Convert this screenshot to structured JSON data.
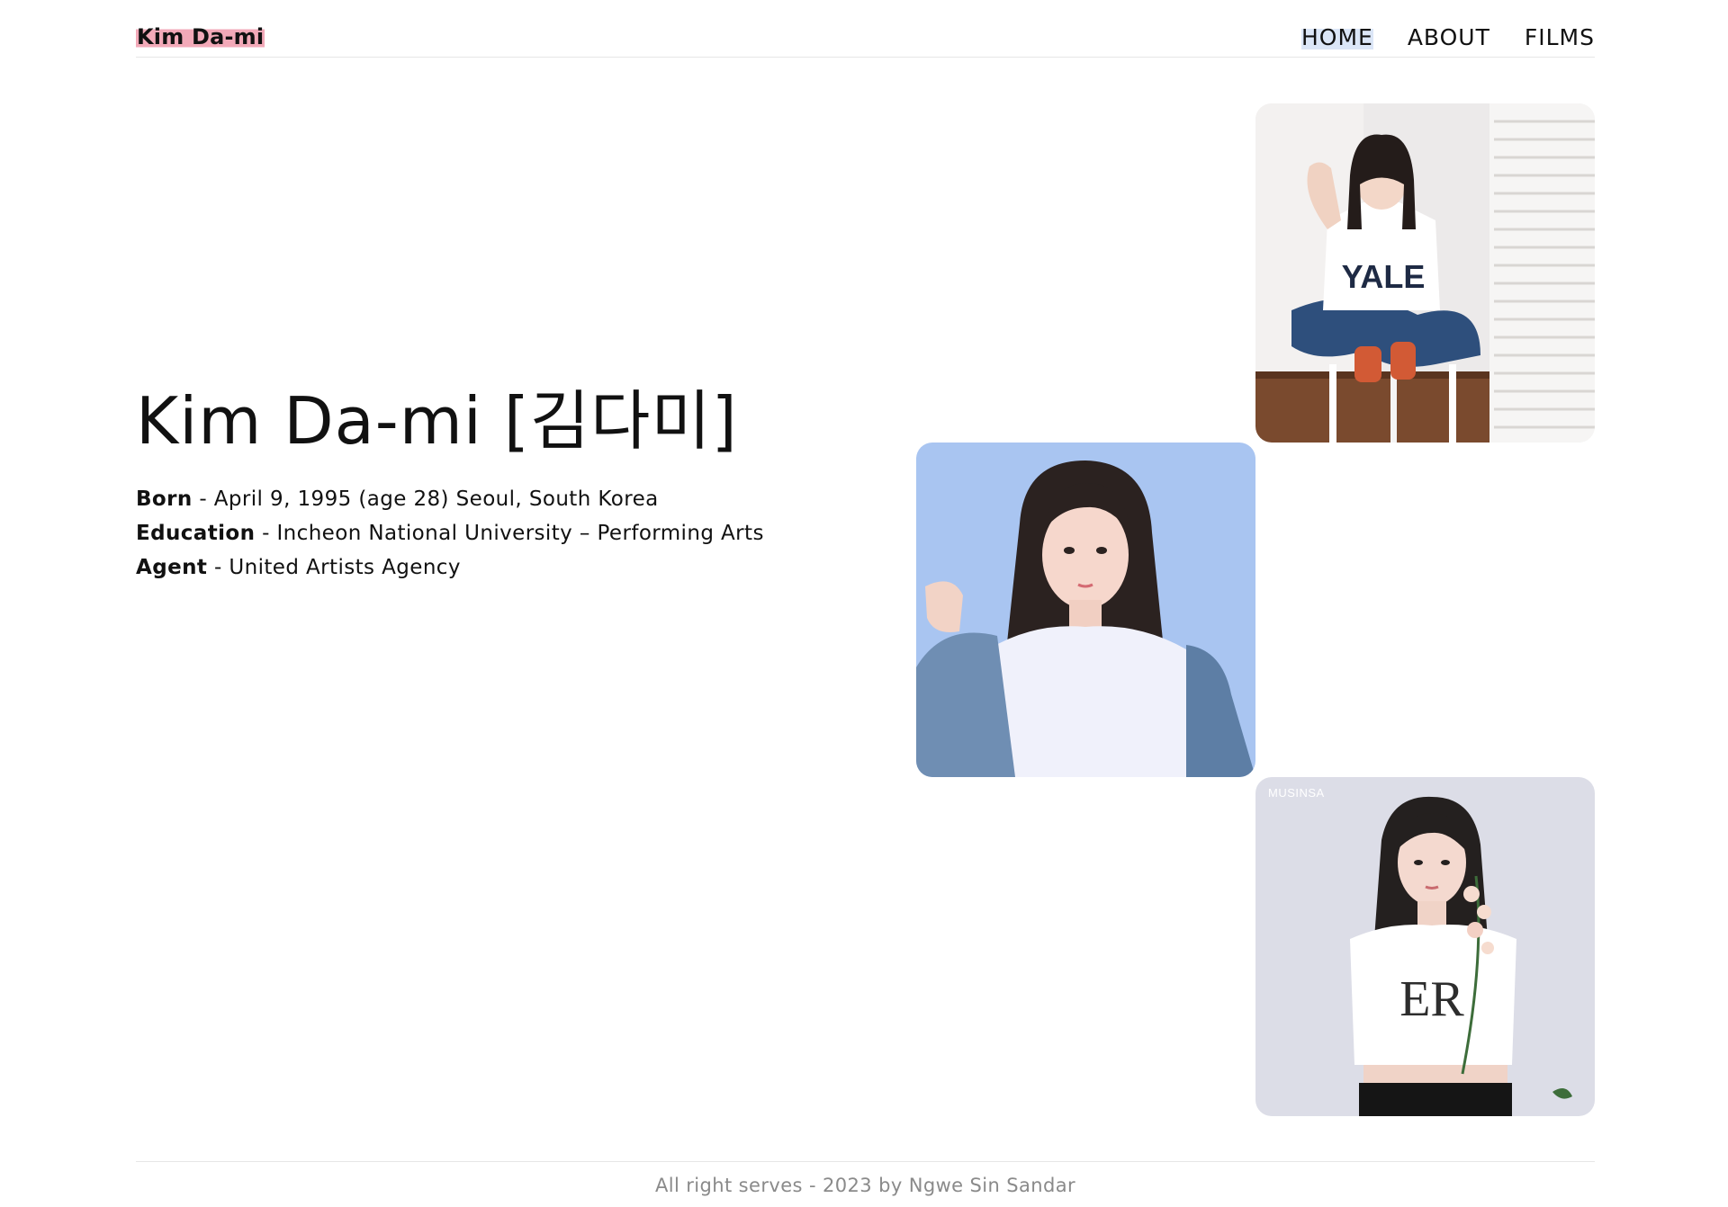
{
  "header": {
    "logo": "Kim Da-mi",
    "nav": [
      {
        "label": "HOME",
        "active": true
      },
      {
        "label": "ABOUT",
        "active": false
      },
      {
        "label": "FILMS",
        "active": false
      }
    ]
  },
  "hero": {
    "title": "Kim Da-mi [김다미]",
    "facts": [
      {
        "label": "Born",
        "sep": " - ",
        "value": "April 9, 1995 (age 28) Seoul, South Korea"
      },
      {
        "label": "Education",
        "sep": " - ",
        "value": "Incheon National University – Performing Arts"
      },
      {
        "label": "Agent",
        "sep": " - ",
        "value": "United Artists Agency"
      }
    ]
  },
  "photos": {
    "third_watermark": "MUSINSA"
  },
  "colors": {
    "logo_highlight": "#f2a9b8",
    "nav_active_highlight": "#dbe6f7",
    "footer_text": "#8a8a8a"
  },
  "footer": {
    "text": "All right serves - 2023 by Ngwe Sin Sandar"
  }
}
